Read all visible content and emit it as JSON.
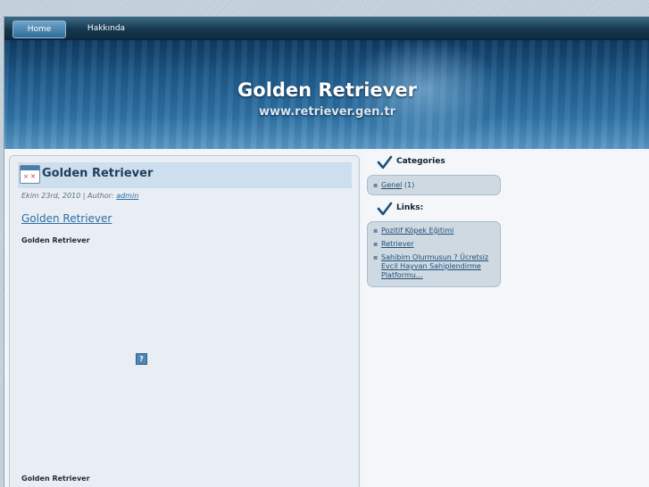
{
  "nav": {
    "items": [
      {
        "label": "Home",
        "active": true
      },
      {
        "label": "Hakkında",
        "active": false
      }
    ]
  },
  "header": {
    "title": "Golden Retriever",
    "url": "www.retriever.gen.tr"
  },
  "post": {
    "title": "Golden Retriever",
    "date": "Ekim 23rd, 2010 | Author:",
    "author": "admin",
    "link_title": "Golden Retriever",
    "body_heading_top": "Golden Retriever",
    "body_heading_bottom": "Golden Retriever"
  },
  "sidebar": {
    "categories_title": "Categories",
    "categories": [
      {
        "label": "Genel",
        "count": "(1)"
      }
    ],
    "links_title": "Links:",
    "links": [
      {
        "label": "Pozitif Köpek Eğitimi"
      },
      {
        "label": "Retriever"
      },
      {
        "line1": "Sahibim Olurmusun ? Ücretsiz",
        "line2": "Evcil Hayvan Sahiplendirme",
        "line3": "Platformu…"
      }
    ]
  },
  "colors": {
    "accent": "#2f6da1",
    "header_dark": "#0f3a63",
    "box_bg": "#ced9e2"
  }
}
